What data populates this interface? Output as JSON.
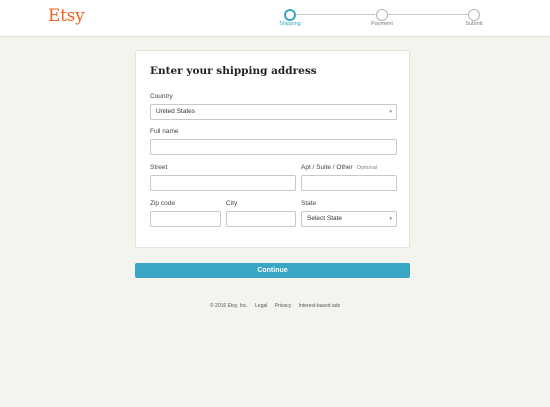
{
  "header": {
    "logo": "Etsy",
    "steps": [
      {
        "label": "Shipping"
      },
      {
        "label": "Payment"
      },
      {
        "label": "Submit"
      }
    ]
  },
  "form": {
    "title": "Enter your shipping address",
    "country": {
      "label": "Country",
      "value": "United States"
    },
    "full_name": {
      "label": "Full name",
      "value": ""
    },
    "street": {
      "label": "Street",
      "value": ""
    },
    "apt": {
      "label": "Apt / Suite / Other",
      "optional": "Optional",
      "value": ""
    },
    "zip": {
      "label": "Zip code",
      "value": ""
    },
    "city": {
      "label": "City",
      "value": ""
    },
    "state": {
      "label": "State",
      "value": "Select State"
    }
  },
  "actions": {
    "continue_label": "Continue"
  },
  "footer": {
    "copyright": "© 2016 Etsy, Inc.",
    "links": [
      "Legal",
      "Privacy",
      "Interest-based ads"
    ]
  },
  "colors": {
    "brand": "#f1641e",
    "accent": "#39a6c6",
    "background": "#f4f4ef"
  }
}
